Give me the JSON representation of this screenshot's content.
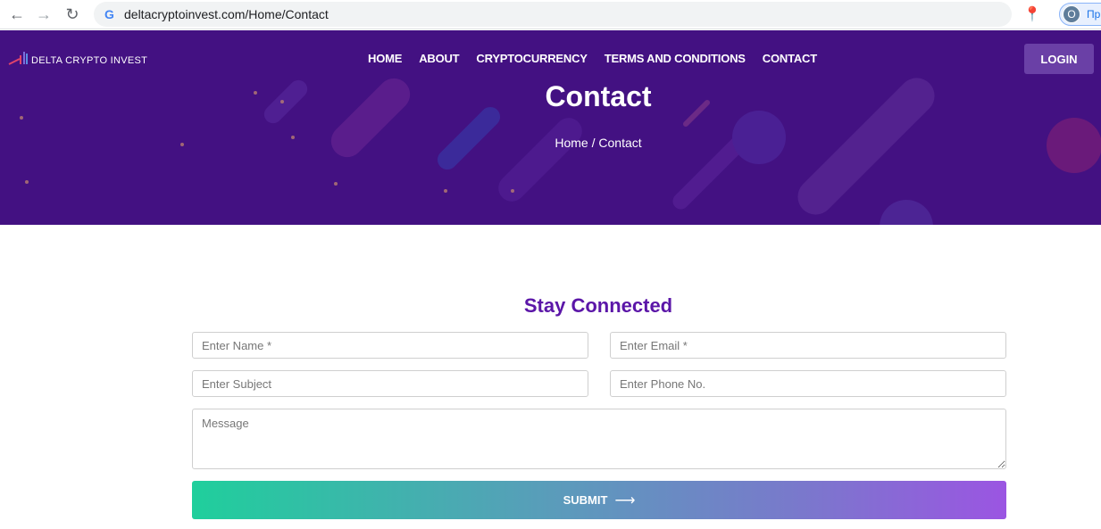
{
  "browser": {
    "url": "deltacryptoinvest.com/Home/Contact",
    "profile_initial": "O",
    "profile_label": "Пр"
  },
  "site": {
    "logo_text": "DELTA CRYPTO INVEST",
    "nav": [
      "HOME",
      "ABOUT",
      "CRYPTOCURRENCY",
      "TERMS AND CONDITIONS",
      "CONTACT"
    ],
    "login_label": "LOGIN"
  },
  "hero": {
    "title": "Contact",
    "breadcrumb_home": "Home",
    "breadcrumb_separator": "/",
    "breadcrumb_current": "Contact"
  },
  "form": {
    "title": "Stay Connected",
    "name_placeholder": "Enter Name *",
    "email_placeholder": "Enter Email *",
    "subject_placeholder": "Enter Subject",
    "phone_placeholder": "Enter Phone No.",
    "message_placeholder": "Message",
    "submit_label": "SUBMIT"
  },
  "colors": {
    "hero_bg": "#431182",
    "accent_title": "#5b16a8",
    "login_bg": "#6a40a6",
    "submit_gradient_start": "#1fcf9c",
    "submit_gradient_end": "#9b55e2"
  }
}
